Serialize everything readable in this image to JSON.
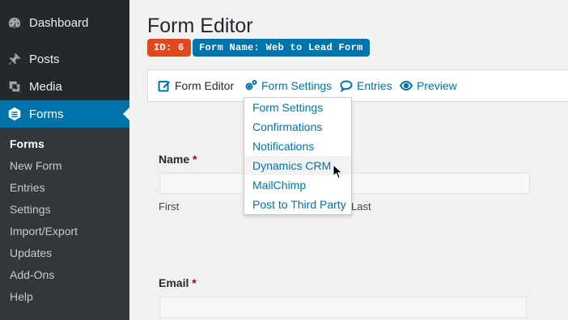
{
  "sidebar": {
    "items": [
      {
        "label": "Dashboard",
        "icon": "dashboard-icon"
      },
      {
        "label": "Posts",
        "icon": "pin-icon"
      },
      {
        "label": "Media",
        "icon": "media-icon"
      },
      {
        "label": "Forms",
        "icon": "forms-icon"
      }
    ],
    "submenu": [
      "Forms",
      "New Form",
      "Entries",
      "Settings",
      "Import/Export",
      "Updates",
      "Add-Ons",
      "Help"
    ],
    "colors": {
      "background": "#23282d",
      "active": "#0073aa",
      "submenu": "#32373c"
    }
  },
  "header": {
    "title": "Form Editor",
    "id_badge": "ID: 6",
    "name_badge": "Form Name: Web to Lead Form",
    "colors": {
      "id_badge": "#dd4a1f",
      "name_badge": "#0073aa"
    }
  },
  "toolbar": {
    "items": [
      {
        "label": "Form Editor",
        "icon": "edit-icon"
      },
      {
        "label": "Form Settings",
        "icon": "gears-icon"
      },
      {
        "label": "Entries",
        "icon": "comment-icon"
      },
      {
        "label": "Preview",
        "icon": "eye-icon"
      }
    ]
  },
  "dropdown": {
    "items": [
      "Form Settings",
      "Confirmations",
      "Notifications",
      "Dynamics CRM",
      "MailChimp",
      "Post to Third Party"
    ],
    "hovered": "Dynamics CRM"
  },
  "form": {
    "name_label": "Name",
    "email_label": "Email",
    "required_mark": "*",
    "first_label": "First",
    "last_label": "Last"
  }
}
